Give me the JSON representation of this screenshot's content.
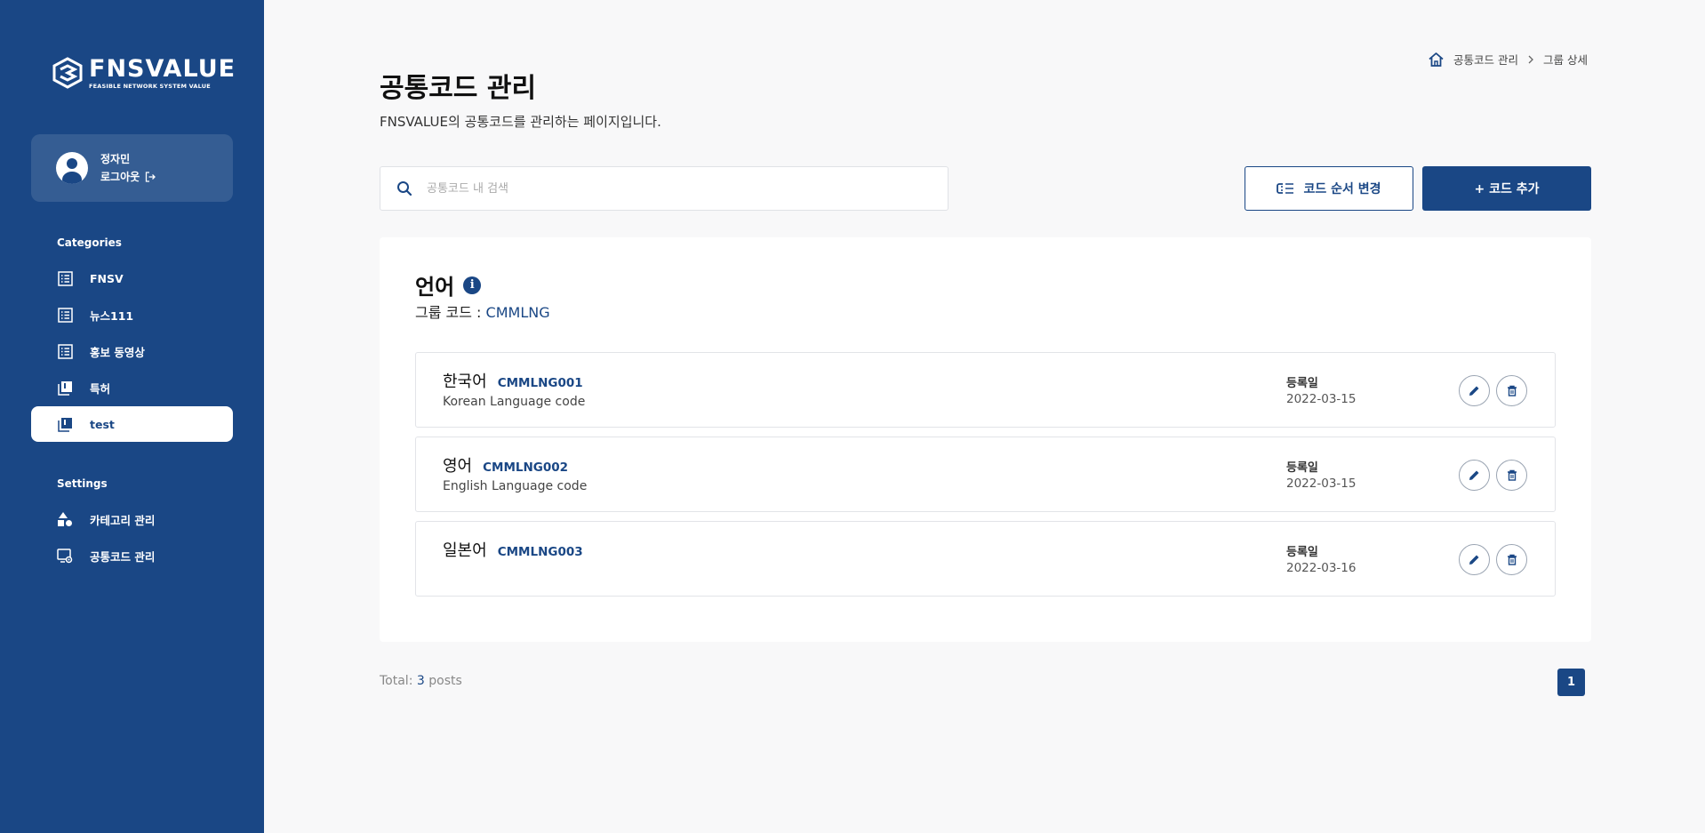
{
  "sidebar": {
    "logo_word": "FNSVALUE",
    "logo_sub": "FEASIBLE NETWORK SYSTEM VALUE",
    "user_name": "정자민",
    "logout_label": "로그아웃",
    "categories_title": "Categories",
    "categories": [
      {
        "label": "FNSV",
        "icon": "list-icon"
      },
      {
        "label": "뉴스111",
        "icon": "list-icon"
      },
      {
        "label": "홍보 동영상",
        "icon": "list-icon"
      },
      {
        "label": "특허",
        "icon": "library-icon"
      },
      {
        "label": "test",
        "icon": "library-icon",
        "active": true
      }
    ],
    "settings_title": "Settings",
    "settings": [
      {
        "label": "카테고리 관리",
        "icon": "shapes-icon"
      },
      {
        "label": "공통코드 관리",
        "icon": "screen-settings-icon"
      }
    ]
  },
  "breadcrumb": {
    "items": [
      "공통코드 관리",
      "그룹 상세"
    ]
  },
  "page": {
    "title": "공통코드 관리",
    "description": "FNSVALUE의 공통코드를 관리하는 페이지입니다."
  },
  "search": {
    "placeholder": "공통코드 내 검색",
    "value": ""
  },
  "actions": {
    "order_label": "코드 순서 변경",
    "add_label": "+ 코드 추가"
  },
  "group": {
    "name": "언어",
    "code_label": "그룹 코드 : ",
    "code": "CMMLNG"
  },
  "codes": [
    {
      "name": "한국어",
      "code": "CMMLNG001",
      "desc": "Korean Language code",
      "date_label": "등록일",
      "date": "2022-03-15"
    },
    {
      "name": "영어",
      "code": "CMMLNG002",
      "desc": "English Language code",
      "date_label": "등록일",
      "date": "2022-03-15"
    },
    {
      "name": "일본어",
      "code": "CMMLNG003",
      "desc": "",
      "date_label": "등록일",
      "date": "2022-03-16"
    }
  ],
  "footer": {
    "total_prefix": "Total: ",
    "total_count": "3",
    "total_suffix": " posts",
    "current_page": "1"
  },
  "colors": {
    "brand": "#1a4785",
    "background": "#f8f8f9"
  }
}
